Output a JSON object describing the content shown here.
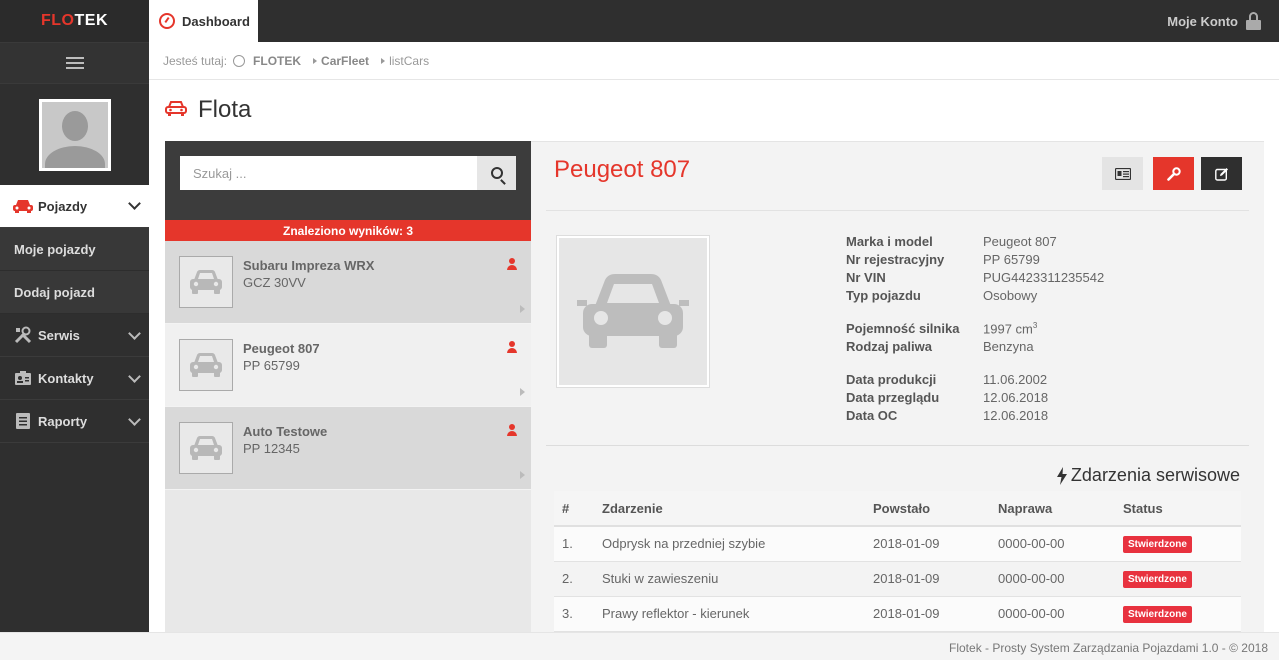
{
  "app": {
    "logo_red": "FLO",
    "logo_white": "TEK"
  },
  "topbar": {
    "dashboard_tab": "Dashboard",
    "account": "Moje Konto"
  },
  "breadcrumb": {
    "prefix": "Jesteś tutaj:",
    "items": [
      "FLOTEK",
      "CarFleet",
      "listCars"
    ]
  },
  "sidebar": {
    "items": [
      {
        "label": "Pojazdy",
        "icon": "car-icon",
        "active": true
      },
      {
        "label": "Moje pojazdy"
      },
      {
        "label": "Dodaj pojazd"
      },
      {
        "label": "Serwis",
        "icon": "tools-icon"
      },
      {
        "label": "Kontakty",
        "icon": "contacts-icon"
      },
      {
        "label": "Raporty",
        "icon": "report-icon"
      }
    ]
  },
  "page": {
    "title": "Flota"
  },
  "search": {
    "placeholder": "Szukaj ..."
  },
  "results": {
    "label": "Znaleziono wyników: 3"
  },
  "cars": [
    {
      "name": "Subaru Impreza WRX",
      "plate": "GCZ 30VV"
    },
    {
      "name": "Peugeot 807",
      "plate": "PP 65799"
    },
    {
      "name": "Auto Testowe",
      "plate": "PP 12345"
    }
  ],
  "detail": {
    "title": "Peugeot 807",
    "specs": {
      "make_label": "Marka i model",
      "make": "Peugeot 807",
      "reg_label": "Nr rejestracyjny",
      "reg": "PP 65799",
      "vin_label": "Nr VIN",
      "vin": "PUG4423311235542",
      "type_label": "Typ pojazdu",
      "type": "Osobowy",
      "engine_label": "Pojemność silnika",
      "engine": "1997 cm",
      "engine_unit_sup": "3",
      "fuel_label": "Rodzaj paliwa",
      "fuel": "Benzyna",
      "prod_label": "Data produkcji",
      "prod": "11.06.2002",
      "inspection_label": "Data przeglądu",
      "inspection": "12.06.2018",
      "oc_label": "Data OC",
      "oc": "12.06.2018"
    }
  },
  "events": {
    "title": "Zdarzenia serwisowe",
    "headers": [
      "#",
      "Zdarzenie",
      "Powstało",
      "Naprawa",
      "Status"
    ],
    "rows": [
      {
        "num": "1.",
        "event": "Odprysk na przedniej szybie",
        "created": "2018-01-09",
        "repair": "0000-00-00",
        "status": "Stwierdzone"
      },
      {
        "num": "2.",
        "event": "Stuki w zawieszeniu",
        "created": "2018-01-09",
        "repair": "0000-00-00",
        "status": "Stwierdzone"
      },
      {
        "num": "3.",
        "event": "Prawy reflektor - kierunek",
        "created": "2018-01-09",
        "repair": "0000-00-00",
        "status": "Stwierdzone"
      }
    ]
  },
  "footer": {
    "text": "Flotek - Prosty System Zarządzania Pojazdami 1.0 - © 2018"
  },
  "colors": {
    "accent": "#e5362b",
    "sidebar": "#2f2f2f",
    "badge": "#e8323f"
  }
}
